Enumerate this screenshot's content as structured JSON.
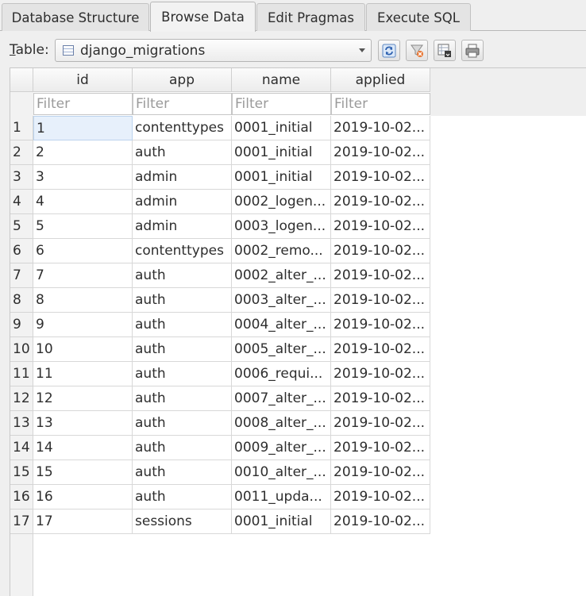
{
  "tabs": [
    {
      "label": "Database Structure",
      "active": false
    },
    {
      "label": "Browse Data",
      "active": true
    },
    {
      "label": "Edit Pragmas",
      "active": false
    },
    {
      "label": "Execute SQL",
      "active": false
    }
  ],
  "toolbar": {
    "table_label_first": "T",
    "table_label_rest": "able:",
    "table_name": "django_migrations",
    "buttons": [
      {
        "name": "refresh-icon"
      },
      {
        "name": "clear-filters-icon"
      },
      {
        "name": "save-table-icon"
      },
      {
        "name": "print-icon"
      }
    ]
  },
  "grid": {
    "columns": [
      "id",
      "app",
      "name",
      "applied"
    ],
    "filter_placeholder": "Filter",
    "rows": [
      {
        "num": "1",
        "id": "1",
        "app": "contenttypes",
        "name": "0001_initial",
        "applied": "2019-10-02..."
      },
      {
        "num": "2",
        "id": "2",
        "app": "auth",
        "name": "0001_initial",
        "applied": "2019-10-02..."
      },
      {
        "num": "3",
        "id": "3",
        "app": "admin",
        "name": "0001_initial",
        "applied": "2019-10-02..."
      },
      {
        "num": "4",
        "id": "4",
        "app": "admin",
        "name": "0002_logen...",
        "applied": "2019-10-02..."
      },
      {
        "num": "5",
        "id": "5",
        "app": "admin",
        "name": "0003_logen...",
        "applied": "2019-10-02..."
      },
      {
        "num": "6",
        "id": "6",
        "app": "contenttypes",
        "name": "0002_remo...",
        "applied": "2019-10-02..."
      },
      {
        "num": "7",
        "id": "7",
        "app": "auth",
        "name": "0002_alter_...",
        "applied": "2019-10-02..."
      },
      {
        "num": "8",
        "id": "8",
        "app": "auth",
        "name": "0003_alter_...",
        "applied": "2019-10-02..."
      },
      {
        "num": "9",
        "id": "9",
        "app": "auth",
        "name": "0004_alter_...",
        "applied": "2019-10-02..."
      },
      {
        "num": "10",
        "id": "10",
        "app": "auth",
        "name": "0005_alter_...",
        "applied": "2019-10-02..."
      },
      {
        "num": "11",
        "id": "11",
        "app": "auth",
        "name": "0006_requi...",
        "applied": "2019-10-02..."
      },
      {
        "num": "12",
        "id": "12",
        "app": "auth",
        "name": "0007_alter_...",
        "applied": "2019-10-02..."
      },
      {
        "num": "13",
        "id": "13",
        "app": "auth",
        "name": "0008_alter_...",
        "applied": "2019-10-02..."
      },
      {
        "num": "14",
        "id": "14",
        "app": "auth",
        "name": "0009_alter_...",
        "applied": "2019-10-02..."
      },
      {
        "num": "15",
        "id": "15",
        "app": "auth",
        "name": "0010_alter_...",
        "applied": "2019-10-02..."
      },
      {
        "num": "16",
        "id": "16",
        "app": "auth",
        "name": "0011_upda...",
        "applied": "2019-10-02..."
      },
      {
        "num": "17",
        "id": "17",
        "app": "sessions",
        "name": "0001_initial",
        "applied": "2019-10-02..."
      }
    ]
  }
}
